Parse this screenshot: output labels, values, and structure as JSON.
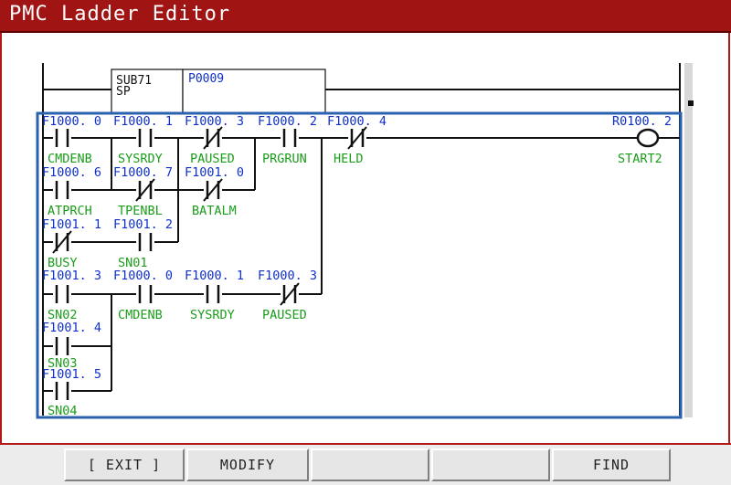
{
  "window": {
    "title": "PMC Ladder Editor"
  },
  "colors": {
    "title_bar": "#a01414",
    "address_text": "#1030c8",
    "symbol_text": "#1a9d1a",
    "selection_border": "#2a62b0",
    "rung_line": "#111111"
  },
  "sub_block": {
    "name_line1": "SUB71",
    "name_line2": "SP",
    "param": "P0009"
  },
  "rung": {
    "row1": [
      {
        "addr": "F1000. 0",
        "symbol": "CMDENB",
        "type": "normally-open"
      },
      {
        "addr": "F1000. 1",
        "symbol": "SYSRDY",
        "type": "normally-open"
      },
      {
        "addr": "F1000. 3",
        "symbol": "PAUSED",
        "type": "normally-closed"
      },
      {
        "addr": "F1000. 2",
        "symbol": "PRGRUN",
        "type": "normally-open"
      },
      {
        "addr": "F1000. 4",
        "symbol": "HELD",
        "type": "normally-closed"
      }
    ],
    "coil": {
      "addr": "R0100. 2",
      "symbol": "START2"
    },
    "row2": [
      {
        "addr": "F1000. 6",
        "symbol": "ATPRCH",
        "type": "normally-open"
      },
      {
        "addr": "F1000. 7",
        "symbol": "TPENBL",
        "type": "normally-closed"
      },
      {
        "addr": "F1001. 0",
        "symbol": "BATALM",
        "type": "normally-closed"
      }
    ],
    "row3": [
      {
        "addr": "F1001. 1",
        "symbol": "BUSY",
        "type": "normally-closed"
      },
      {
        "addr": "F1001. 2",
        "symbol": "SN01",
        "type": "normally-open"
      }
    ],
    "row4": [
      {
        "addr": "F1001. 3",
        "symbol": "SN02",
        "type": "normally-open"
      },
      {
        "addr": "F1000. 0",
        "symbol": "CMDENB",
        "type": "normally-open"
      },
      {
        "addr": "F1000. 1",
        "symbol": "SYSRDY",
        "type": "normally-open"
      },
      {
        "addr": "F1000. 3",
        "symbol": "PAUSED",
        "type": "normally-closed"
      }
    ],
    "row5": [
      {
        "addr": "F1001. 4",
        "symbol": "SN03",
        "type": "normally-open"
      }
    ],
    "row6": [
      {
        "addr": "F1001. 5",
        "symbol": "SN04",
        "type": "normally-open"
      }
    ]
  },
  "softkeys": [
    {
      "label": "[ EXIT ]"
    },
    {
      "label": "MODIFY"
    },
    {
      "label": ""
    },
    {
      "label": ""
    },
    {
      "label": "FIND"
    }
  ]
}
